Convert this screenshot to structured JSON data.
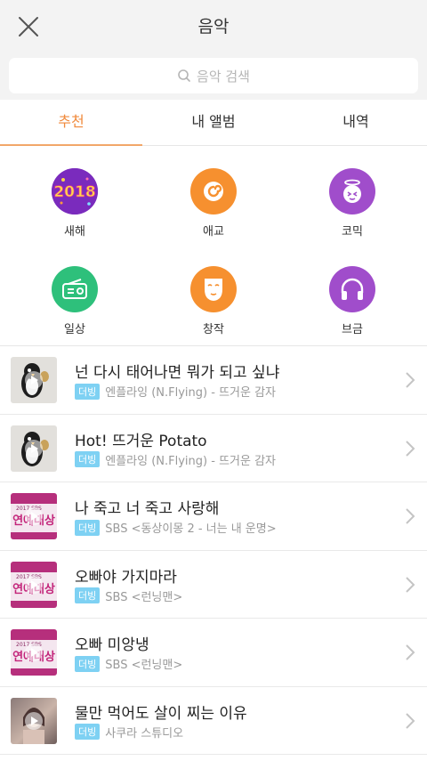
{
  "header": {
    "title": "음악",
    "close_icon": "close-icon"
  },
  "search": {
    "placeholder": "음악 검색",
    "icon": "search-icon"
  },
  "tabs": [
    {
      "label": "추천",
      "active": true
    },
    {
      "label": "내 앨범",
      "active": false
    },
    {
      "label": "내역",
      "active": false
    }
  ],
  "categories": [
    {
      "label": "새해",
      "icon": "2018-icon",
      "color": "#7f2fc1"
    },
    {
      "label": "애교",
      "icon": "swirl-icon",
      "color": "#f6902f"
    },
    {
      "label": "코믹",
      "icon": "angel-face-icon",
      "color": "#a04dcb"
    },
    {
      "label": "일상",
      "icon": "radio-icon",
      "color": "#2ec07b"
    },
    {
      "label": "창작",
      "icon": "mask-icon",
      "color": "#f6902f"
    },
    {
      "label": "브금",
      "icon": "headphones-icon",
      "color": "#a04dcb"
    }
  ],
  "songs": [
    {
      "title": "넌 다시 태어나면 뭐가 되고 싶냐",
      "badge": "더빙",
      "source": "엔플라잉 (N.Flying) - 뜨거운 감자",
      "thumb": "penguin"
    },
    {
      "title": "Hot! 뜨거운 Potato",
      "badge": "더빙",
      "source": "엔플라잉 (N.Flying) - 뜨거운 감자",
      "thumb": "penguin"
    },
    {
      "title": "나 죽고 너 죽고 사랑해",
      "badge": "더빙",
      "source": "SBS <동상이몽 2 - 너는 내 운명>",
      "thumb": "sbs",
      "thumb_text": "연예대상",
      "thumb_year": "2017 SBS"
    },
    {
      "title": "오빠야 가지마라",
      "badge": "더빙",
      "source": "SBS <런닝맨>",
      "thumb": "sbs",
      "thumb_text": "연예대상",
      "thumb_year": "2017 SBS"
    },
    {
      "title": "오빠 미앙냉",
      "badge": "더빙",
      "source": "SBS <런닝맨>",
      "thumb": "sbs",
      "thumb_text": "연예대상",
      "thumb_year": "2017 SBS"
    },
    {
      "title": "물만 먹어도 살이 찌는 이유",
      "badge": "더빙",
      "source": "사쿠라 스튜디오",
      "thumb": "photo"
    }
  ]
}
